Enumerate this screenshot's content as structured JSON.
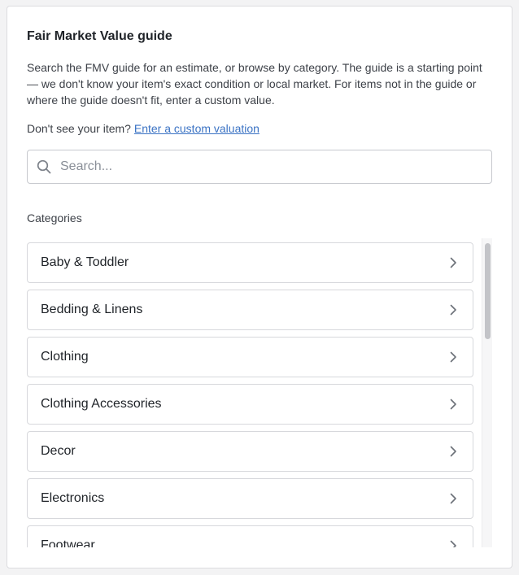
{
  "guide": {
    "title": "Fair Market Value guide",
    "description": "Search the FMV guide for an estimate, or browse by category. The guide is a starting point — we don't know your item's exact condition or local market. For items not in the guide or where the guide doesn't fit, enter a custom value.",
    "custom_prompt": "Don't see your item?",
    "custom_link": "Enter a custom valuation"
  },
  "search": {
    "placeholder": "Search...",
    "value": "",
    "icon": "search-icon"
  },
  "categories": {
    "heading": "Categories",
    "items": [
      {
        "label": "Baby & Toddler"
      },
      {
        "label": "Bedding & Linens"
      },
      {
        "label": "Clothing"
      },
      {
        "label": "Clothing Accessories"
      },
      {
        "label": "Decor"
      },
      {
        "label": "Electronics"
      },
      {
        "label": "Footwear"
      }
    ],
    "item_icon": "chevron-right-icon"
  },
  "colors": {
    "link": "#3b73c4",
    "border": "#d7d8dc",
    "text": "#1f2328"
  }
}
